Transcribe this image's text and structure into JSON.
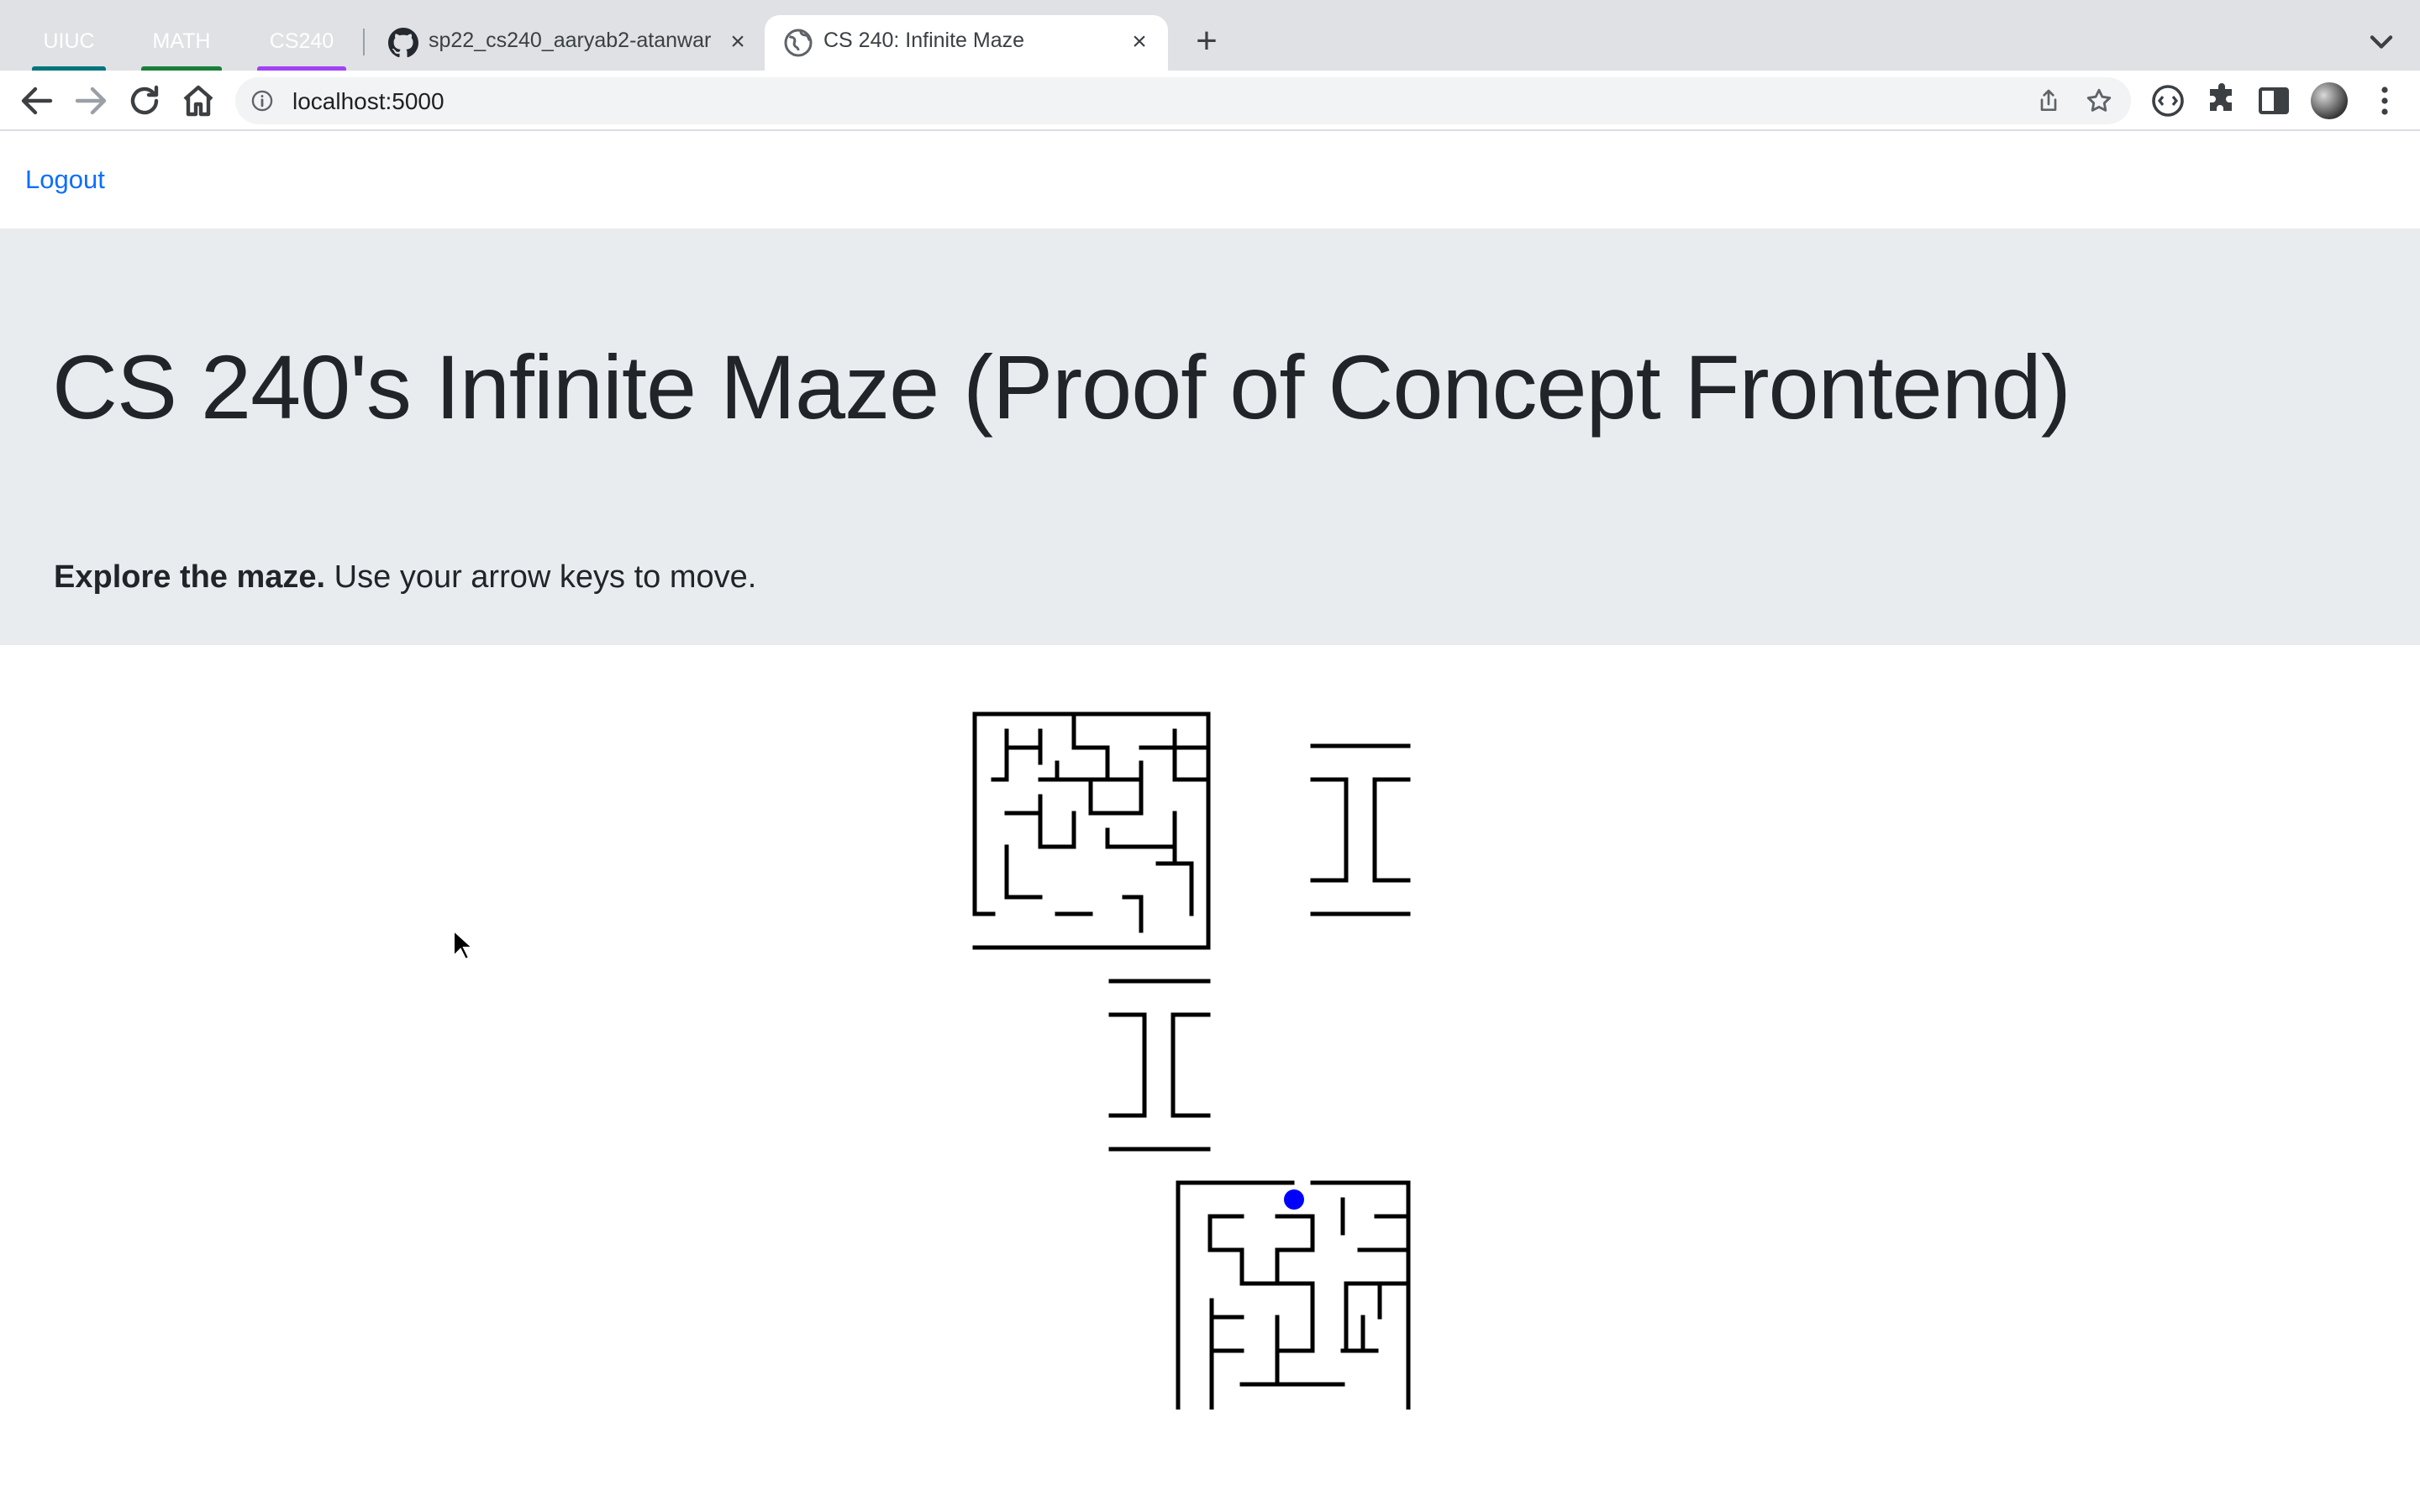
{
  "browser": {
    "tab_groups": [
      {
        "label": "UIUC",
        "color": "#00757c"
      },
      {
        "label": "MATH",
        "color": "#188038"
      },
      {
        "label": "CS240",
        "color": "#a142f4"
      }
    ],
    "tabs": [
      {
        "title": "sp22_cs240_aaryab2-atanwar",
        "favicon": "github-icon",
        "active": false
      },
      {
        "title": "CS 240: Infinite Maze",
        "favicon": "globe-icon",
        "active": true
      }
    ],
    "url": "localhost:5000"
  },
  "page": {
    "logout_label": "Logout",
    "title": "CS 240's Infinite Maze (Proof of Concept Frontend)",
    "subtitle_bold": "Explore the maze.",
    "subtitle_rest": " Use your arrow keys to move."
  },
  "maze": {
    "wall_color": "#000000",
    "player_color": "#0000ff"
  }
}
